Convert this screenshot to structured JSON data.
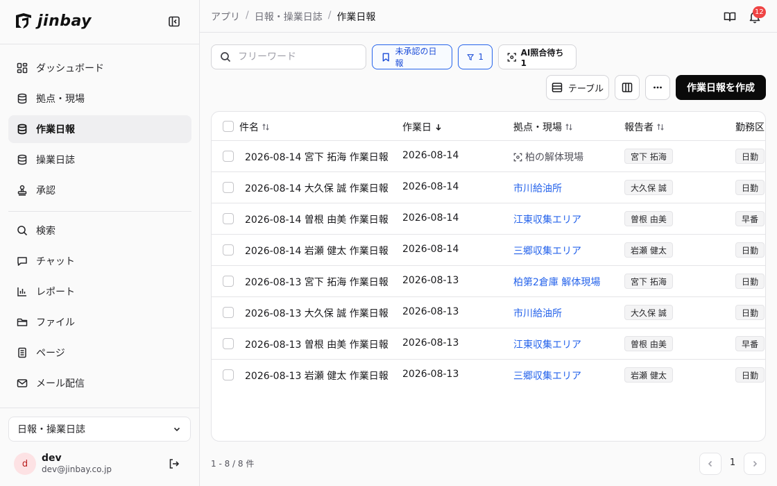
{
  "brand": {
    "name": "jinbay"
  },
  "sidebar": {
    "items": [
      {
        "label": "ダッシュボード",
        "icon": "dashboard-icon"
      },
      {
        "label": "拠点・現場",
        "icon": "database-icon"
      },
      {
        "label": "作業日報",
        "icon": "database-icon",
        "active": true
      },
      {
        "label": "操業日誌",
        "icon": "database-icon"
      },
      {
        "label": "承認",
        "icon": "stamp-icon"
      },
      {
        "label": "検索",
        "icon": "search-icon"
      },
      {
        "label": "チャット",
        "icon": "chat-icon"
      },
      {
        "label": "レポート",
        "icon": "chart-icon"
      },
      {
        "label": "ファイル",
        "icon": "folder-icon"
      },
      {
        "label": "ページ",
        "icon": "page-icon"
      },
      {
        "label": "メール配信",
        "icon": "mail-icon"
      }
    ],
    "workspace": "日報・操業日誌",
    "user": {
      "initial": "d",
      "name": "dev",
      "email": "dev@jinbay.co.jp"
    }
  },
  "breadcrumb": {
    "items": [
      "アプリ",
      "日報・操業日誌"
    ],
    "current": "作業日報"
  },
  "notifications": {
    "count": "12"
  },
  "search": {
    "placeholder": "フリーワード"
  },
  "filters": {
    "unapproved": "未承認の日報",
    "filter_count": "1",
    "ai_pending": "AI照合待ち 1"
  },
  "toolbar": {
    "table": "テーブル",
    "create": "作業日報を作成"
  },
  "table": {
    "columns": [
      "件名",
      "作業日",
      "拠点・現場",
      "報告者",
      "勤務区"
    ],
    "rows": [
      {
        "title": "2026-08-14 宮下 拓海 作業日報",
        "date": "2026-08-14",
        "site": "柏の解体現場",
        "reporter": "宮下 拓海",
        "shift": "日勤",
        "pending": true
      },
      {
        "title": "2026-08-14 大久保 誠 作業日報",
        "date": "2026-08-14",
        "site": "市川給油所",
        "reporter": "大久保 誠",
        "shift": "日勤"
      },
      {
        "title": "2026-08-14 曽根 由美 作業日報",
        "date": "2026-08-14",
        "site": "江東収集エリア",
        "reporter": "曽根 由美",
        "shift": "早番"
      },
      {
        "title": "2026-08-14 岩瀬 健太 作業日報",
        "date": "2026-08-14",
        "site": "三郷収集エリア",
        "reporter": "岩瀬 健太",
        "shift": "日勤"
      },
      {
        "title": "2026-08-13 宮下 拓海 作業日報",
        "date": "2026-08-13",
        "site": "柏第2倉庫 解体現場",
        "reporter": "宮下 拓海",
        "shift": "日勤"
      },
      {
        "title": "2026-08-13 大久保 誠 作業日報",
        "date": "2026-08-13",
        "site": "市川給油所",
        "reporter": "大久保 誠",
        "shift": "日勤"
      },
      {
        "title": "2026-08-13 曽根 由美 作業日報",
        "date": "2026-08-13",
        "site": "江東収集エリア",
        "reporter": "曽根 由美",
        "shift": "早番"
      },
      {
        "title": "2026-08-13 岩瀬 健太 作業日報",
        "date": "2026-08-13",
        "site": "三郷収集エリア",
        "reporter": "岩瀬 健太",
        "shift": "日勤"
      }
    ]
  },
  "pagination": {
    "summary": "1 - 8 / 8 件",
    "page": "1"
  },
  "colors": {
    "accent": "#2563eb",
    "badge": "#ef4444",
    "primary_button": "#0a0a0a"
  }
}
